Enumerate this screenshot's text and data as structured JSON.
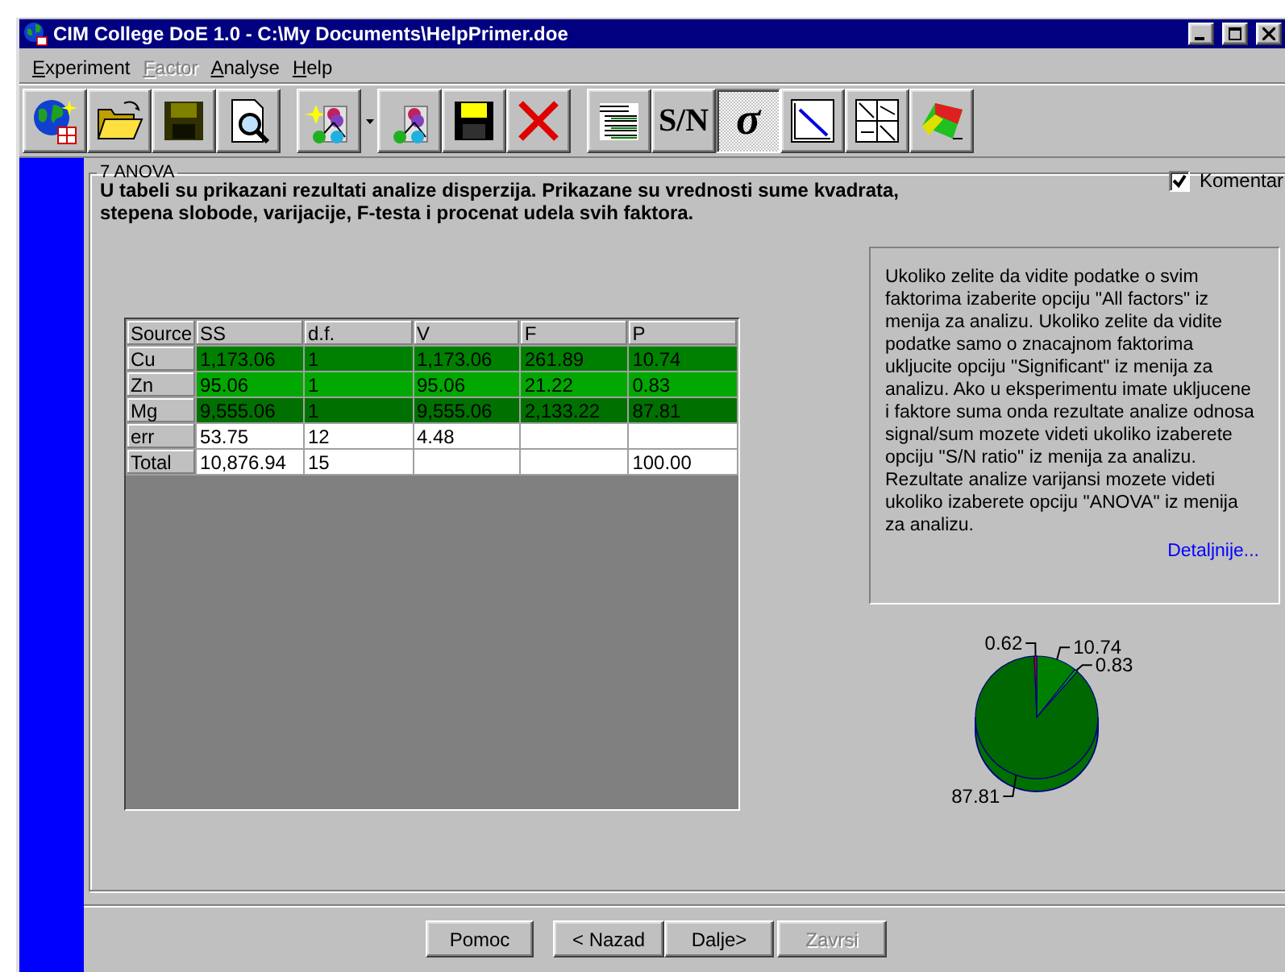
{
  "window": {
    "title": "CIM College DoE 1.0 - C:\\My Documents\\HelpPrimer.doe"
  },
  "menu": [
    {
      "label": "Experiment",
      "disabled": false
    },
    {
      "label": "Factor",
      "disabled": true
    },
    {
      "label": "Analyse",
      "disabled": false
    },
    {
      "label": "Help",
      "disabled": false
    }
  ],
  "toolbar": [
    {
      "items": [
        {
          "kind": "button",
          "selected": false
        },
        {
          "kind": "button",
          "selected": false
        },
        {
          "kind": "button",
          "selected": false
        },
        {
          "kind": "button",
          "selected": false
        }
      ]
    },
    {
      "items": [
        {
          "kind": "button",
          "selected": false
        },
        {
          "kind": "dropdown"
        },
        {
          "kind": "button",
          "selected": false
        },
        {
          "kind": "button",
          "selected": false
        },
        {
          "kind": "button",
          "selected": false
        }
      ]
    },
    {
      "items": [
        {
          "kind": "button",
          "selected": false
        },
        {
          "kind": "button",
          "label": "S/N",
          "selected": false
        },
        {
          "kind": "button",
          "label": "σ",
          "selected": true
        },
        {
          "kind": "button",
          "selected": false
        },
        {
          "kind": "button",
          "selected": false
        },
        {
          "kind": "button",
          "selected": false
        }
      ]
    }
  ],
  "panel": {
    "title": "7 ANOVA",
    "description": "U tabeli su prikazani rezultati analize disperzija. Prikazane su vrednosti sume kvadrata, stepena slobode, varijacije, F-testa i procenat udela svih faktora.",
    "comment_checkbox": {
      "label": "Komentar",
      "checked": true
    }
  },
  "table": {
    "columns": [
      "Source",
      "SS",
      "d.f.",
      "V",
      "F",
      "P"
    ],
    "rows": [
      {
        "cells": [
          "Cu",
          "1,173.06",
          "1",
          "1,173.06",
          "261.89",
          "10.74"
        ],
        "color": "#008000"
      },
      {
        "cells": [
          "Zn",
          "95.06",
          "1",
          "95.06",
          "21.22",
          "0.83"
        ],
        "color": "#00a800"
      },
      {
        "cells": [
          "Mg",
          "9,555.06",
          "1",
          "9,555.06",
          "2,133.22",
          "87.81"
        ],
        "color": "#007000"
      },
      {
        "cells": [
          "err",
          "53.75",
          "12",
          "4.48",
          "",
          ""
        ],
        "color": "#ffffff"
      },
      {
        "cells": [
          "Total",
          "10,876.94",
          "15",
          "",
          "",
          "100.00"
        ],
        "color": "#ffffff"
      }
    ]
  },
  "help": {
    "text": "Ukoliko zelite da vidite podatke o svim faktorima izaberite opciju \"All factors\" iz menija za analizu. Ukoliko zelite da vidite podatke samo o znacajnom faktorima ukljucite opciju \"Significant\" iz menija za analizu. Ako u eksperimentu imate ukljucene i faktore suma onda rezultate analize odnosa signal/sum mozete videti ukoliko izaberete opciju \"S/N ratio\" iz menija za analizu. Rezultate analize varijansi mozete videti ukoliko izaberete opciju \"ANOVA\" iz menija za analizu.",
    "link": "Detaljnije..."
  },
  "chart_data": {
    "type": "pie",
    "values": [
      10.74,
      0.83,
      87.81,
      0.62
    ],
    "data_labels": true
  },
  "buttons": [
    {
      "label": "Pomoc",
      "disabled": false
    },
    {
      "label": "< Nazad",
      "disabled": false
    },
    {
      "label": "Dalje>",
      "disabled": false
    },
    {
      "label": "Zavrsi",
      "disabled": true
    }
  ]
}
